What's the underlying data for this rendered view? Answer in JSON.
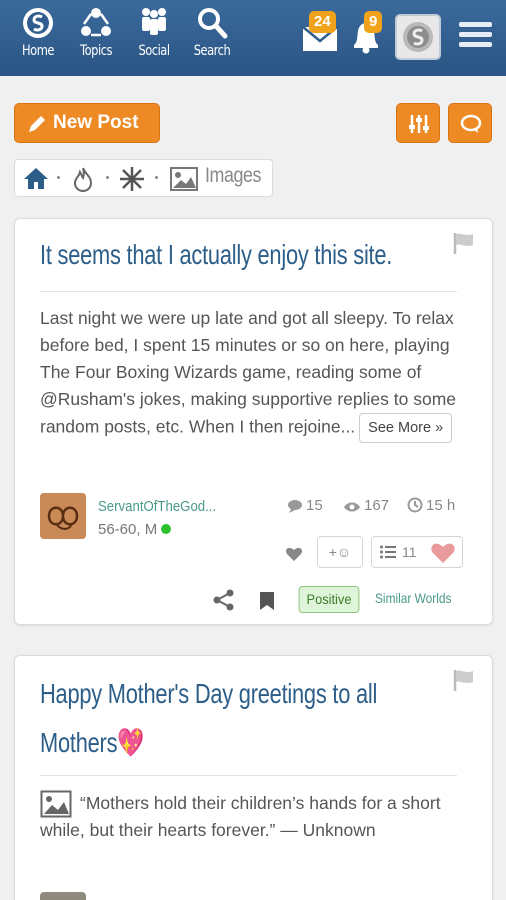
{
  "nav": {
    "items": [
      {
        "label": "Home",
        "icon": "home-logo-icon"
      },
      {
        "label": "Topics",
        "icon": "topics-icon"
      },
      {
        "label": "Social",
        "icon": "social-icon"
      },
      {
        "label": "Search",
        "icon": "search-icon"
      }
    ],
    "messages_count": "24",
    "notifications_count": "9"
  },
  "actions": {
    "new_post_label": "New Post"
  },
  "filter": {
    "images_label": "Images"
  },
  "posts": [
    {
      "title": "It seems that I actually enjoy this site.",
      "body": "Last night we were up late and got all sleepy. To relax before bed, I spent 15 minutes or so on here, playing The Four Boxing Wizards game, reading some of @Rusham's jokes, making supportive replies to some random posts, etc. When I then rejoine...",
      "see_more": "See More »",
      "author": "ServantOfTheGod...",
      "author_meta": "56-60, M",
      "comments": "15",
      "views": "167",
      "age": "15 h",
      "add_reaction": "+☺",
      "reactions_count": "11",
      "tag": "Positive",
      "similar": "Similar Worlds"
    },
    {
      "title_line1": "Happy Mother's Day greetings to all",
      "title_line2": "Mothers💖",
      "body": "“Mothers hold their children’s hands for a short while, but their hearts forever.” — Unknown"
    }
  ],
  "colors": {
    "header": "#2f5d8f",
    "accent": "#ee8a24",
    "title": "#2c5e89",
    "link": "#4a9a8a"
  }
}
